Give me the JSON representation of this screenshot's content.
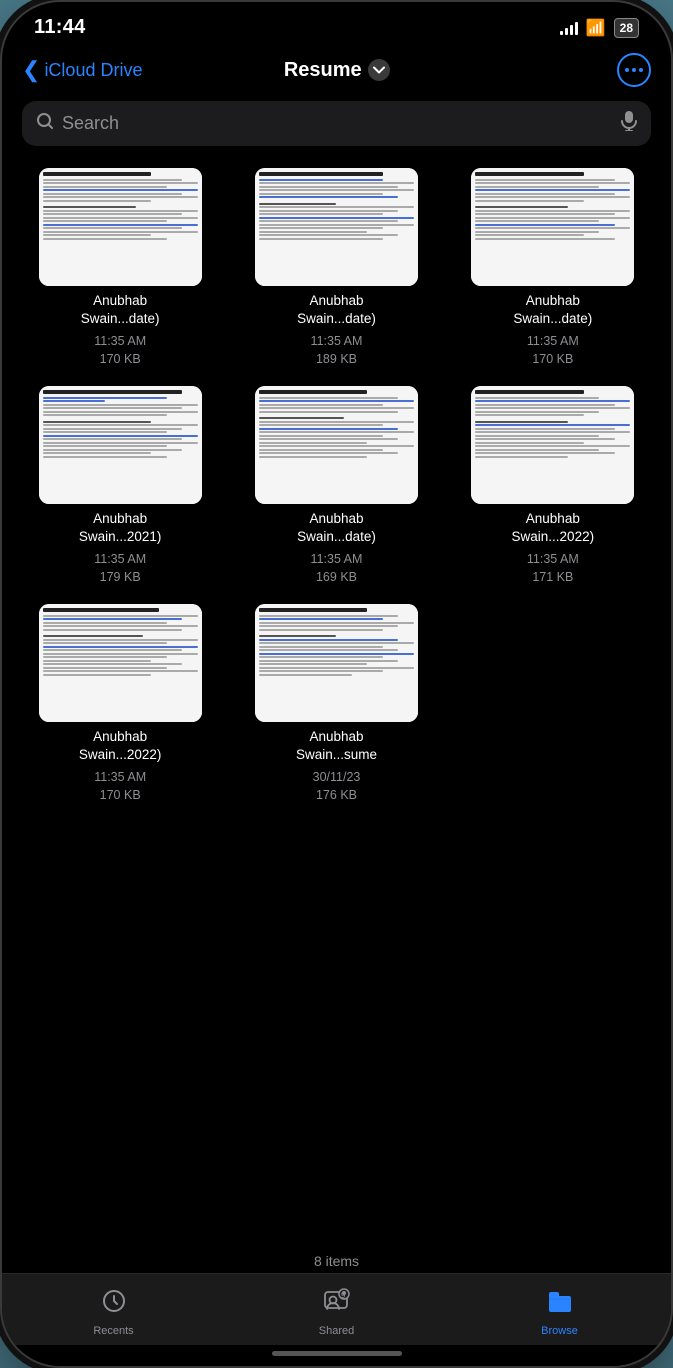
{
  "status": {
    "time": "11:44",
    "battery": "28"
  },
  "nav": {
    "back_label": "iCloud Drive",
    "title": "Resume",
    "more_button_label": "···"
  },
  "search": {
    "placeholder": "Search"
  },
  "files": [
    {
      "name": "Anubhab\nSwain...date)",
      "time": "11:35 AM",
      "size": "170 KB",
      "variant": "a"
    },
    {
      "name": "Anubhab\nSwain...date)",
      "time": "11:35 AM",
      "size": "189 KB",
      "variant": "b"
    },
    {
      "name": "Anubhab\nSwain...date)",
      "time": "11:35 AM",
      "size": "170 KB",
      "variant": "a"
    },
    {
      "name": "Anubhab\nSwain...2021)",
      "time": "11:35 AM",
      "size": "179 KB",
      "variant": "c"
    },
    {
      "name": "Anubhab\nSwain...date)",
      "time": "11:35 AM",
      "size": "169 KB",
      "variant": "d"
    },
    {
      "name": "Anubhab\nSwain...2022)",
      "time": "11:35 AM",
      "size": "171 KB",
      "variant": "a"
    },
    {
      "name": "Anubhab\nSwain...2022)",
      "time": "11:35 AM",
      "size": "170 KB",
      "variant": "e"
    },
    {
      "name": "Anubhab\nSwain...sume",
      "time": "30/11/23",
      "size": "176 KB",
      "variant": "f"
    }
  ],
  "items_count": "8 items",
  "tabs": [
    {
      "id": "recents",
      "label": "Recents",
      "icon": "🕐",
      "active": false
    },
    {
      "id": "shared",
      "label": "Shared",
      "icon": "👥",
      "active": false
    },
    {
      "id": "browse",
      "label": "Browse",
      "icon": "📁",
      "active": true
    }
  ]
}
